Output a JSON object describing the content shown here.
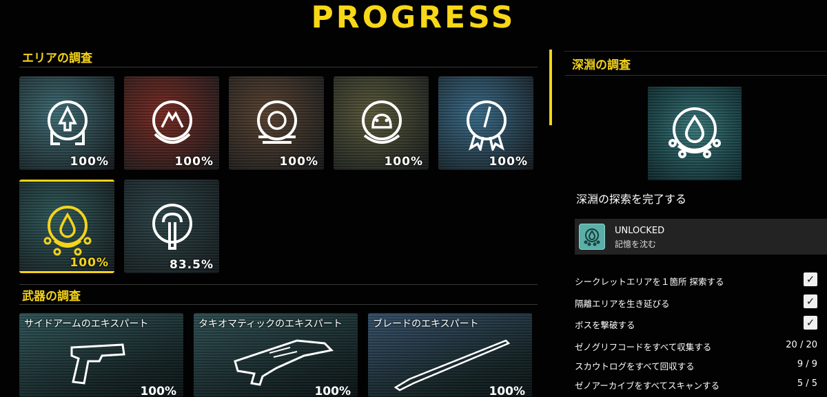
{
  "page": {
    "title": "PROGRESS"
  },
  "area_section": {
    "heading": "エリアの調査"
  },
  "areas": [
    {
      "id": "a1",
      "progress_label": "100%",
      "icon": "forest-emblem-icon",
      "bg": "#3f6e76"
    },
    {
      "id": "a2",
      "progress_label": "100%",
      "icon": "mountain-emblem-icon",
      "bg": "#7a2a22"
    },
    {
      "id": "a3",
      "progress_label": "100%",
      "icon": "ring-emblem-icon",
      "bg": "#5a4230"
    },
    {
      "id": "a4",
      "progress_label": "100%",
      "icon": "frog-emblem-icon",
      "bg": "#5a5a3a"
    },
    {
      "id": "a5",
      "progress_label": "100%",
      "icon": "ribbon-emblem-icon",
      "bg": "#3a6c8a"
    },
    {
      "id": "a6",
      "progress_label": "100%",
      "icon": "abyss-emblem-icon",
      "bg": "#2f5a5c",
      "selected": true
    },
    {
      "id": "a7",
      "progress_label": "83.5%",
      "icon": "tower-emblem-icon",
      "bg": "#2c4448"
    }
  ],
  "weapon_section": {
    "heading": "武器の調査"
  },
  "weapons": [
    {
      "name": "サイドアームのエキスパート",
      "progress_label": "100%",
      "icon": "pistol-icon"
    },
    {
      "name": "タキオマティックのエキスパート",
      "progress_label": "100%",
      "icon": "rifle-icon"
    },
    {
      "name": "ブレードのエキスパート",
      "progress_label": "100%",
      "icon": "blade-icon"
    }
  ],
  "detail": {
    "title": "深淵の調査",
    "subtitle": "深淵の探索を完了する",
    "unlock": {
      "status": "UNLOCKED",
      "reward": "記憶を沈む",
      "icon": "abyss-badge-icon"
    },
    "tasks": [
      {
        "label": "シークレットエリアを１箇所 探索する",
        "done": true
      },
      {
        "label": "隔離エリアを生き延びる",
        "done": true
      },
      {
        "label": "ボスを撃破する",
        "done": true
      },
      {
        "label": "ゼノグリフコードをすべて収集する",
        "value": "20 / 20"
      },
      {
        "label": "スカウトログをすべて回収する",
        "value": "9 / 9"
      },
      {
        "label": "ゼノアーカイブをすべてスキャンする",
        "value": "5 / 5"
      }
    ]
  },
  "colors": {
    "accent": "#f4d31a",
    "background": "#020202"
  }
}
